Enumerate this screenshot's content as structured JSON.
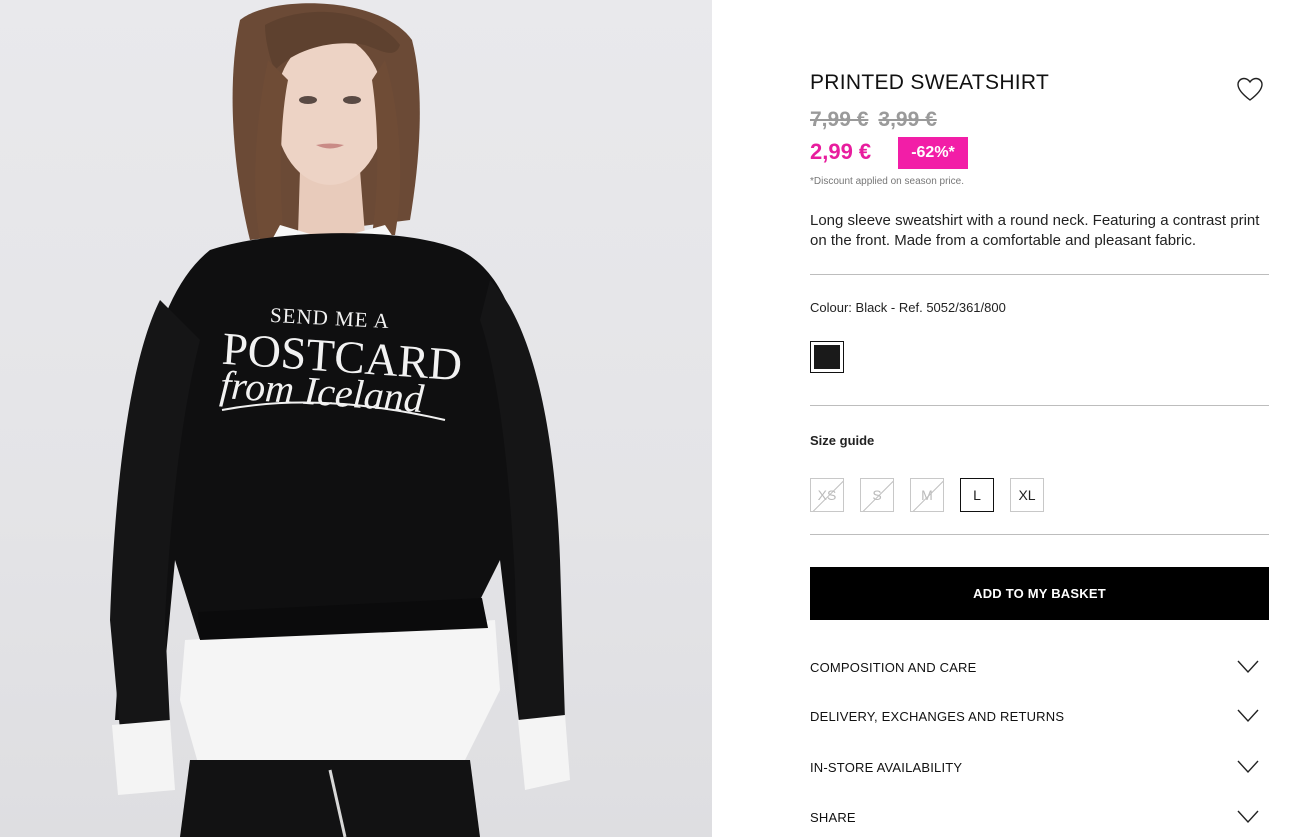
{
  "product": {
    "title": "PRINTED SWEATSHIRT",
    "original_price": "7,99 €",
    "season_price": "3,99 €",
    "current_price": "2,99 €",
    "discount": "-62%*",
    "discount_note": "*Discount applied on season price.",
    "description": "Long sleeve sweatshirt with a round neck. Featuring a contrast print on the front. Made from a comfortable and pleasant fabric.",
    "colour_label": "Colour: Black - Ref. 5052/361/800",
    "swatch_color": "#1a1a1a",
    "size_guide": "Size guide",
    "sizes": [
      {
        "label": "XS",
        "available": false
      },
      {
        "label": "S",
        "available": false
      },
      {
        "label": "M",
        "available": false
      },
      {
        "label": "L",
        "available": true,
        "selected": true
      },
      {
        "label": "XL",
        "available": true
      }
    ],
    "add_to_basket": "ADD TO MY BASKET"
  },
  "photo": {
    "print_line_1": "SEND ME A",
    "print_line_2": "POSTCARD",
    "print_line_3": "from Iceland"
  },
  "accordions": [
    {
      "label": "COMPOSITION AND CARE"
    },
    {
      "label": "DELIVERY, EXCHANGES AND RETURNS"
    },
    {
      "label": "IN-STORE AVAILABILITY"
    },
    {
      "label": "SHARE"
    }
  ],
  "colors": {
    "price_pink": "#e81d9e",
    "badge_pink": "#f21ea7",
    "button_black": "#000000",
    "divider_grey": "#bdbdbd"
  },
  "icons": {
    "wishlist": "heart-icon",
    "accordion": "chevron-down-icon"
  }
}
